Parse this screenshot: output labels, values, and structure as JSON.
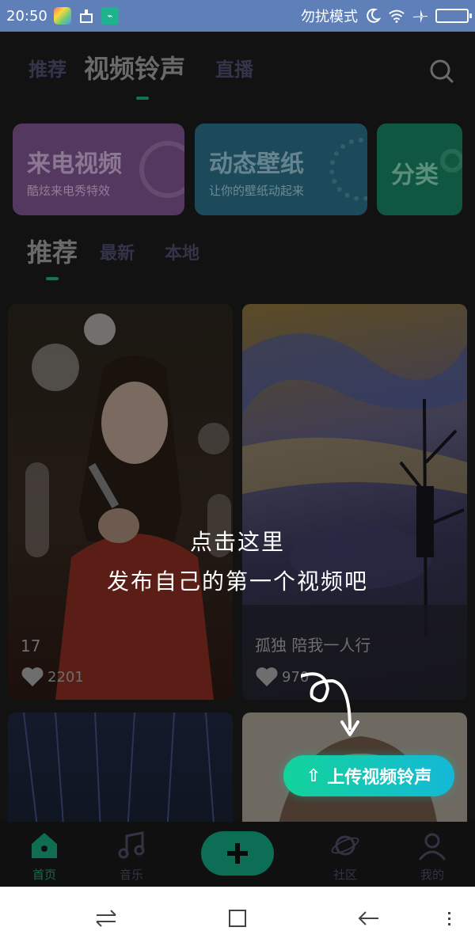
{
  "status_bar": {
    "time": "20:50",
    "dnd_label": "勿扰模式",
    "usb_symbol": "⌁"
  },
  "top_tabs": [
    {
      "label": "推荐"
    },
    {
      "label": "视频铃声"
    },
    {
      "label": "直播"
    }
  ],
  "feature_cards": {
    "video": {
      "title": "来电视频",
      "sub": "酷炫来电秀特效"
    },
    "wallpaper": {
      "title": "动态壁纸",
      "sub": "让你的壁纸动起来"
    },
    "category": {
      "title": "分类"
    }
  },
  "sub_tabs": [
    {
      "label": "推荐"
    },
    {
      "label": "最新"
    },
    {
      "label": "本地"
    }
  ],
  "feed": [
    {
      "caption": "17",
      "likes": "2201"
    },
    {
      "caption": "孤独 陪我一人行",
      "likes": "970"
    }
  ],
  "overlay_hint": {
    "line1": "点击这里",
    "line2": "发布自己的第一个视频吧"
  },
  "upload_button": {
    "label": "上传视频铃声",
    "icon": "⇧"
  },
  "bottom_nav": [
    {
      "label": "首页"
    },
    {
      "label": "音乐"
    },
    {
      "label": "社区"
    },
    {
      "label": "我的"
    }
  ],
  "colors": {
    "accent": "#0f6d52",
    "status_bar": "#5f7fb8",
    "upload_gradient_start": "#13d39a",
    "upload_gradient_end": "#14b8d8"
  }
}
